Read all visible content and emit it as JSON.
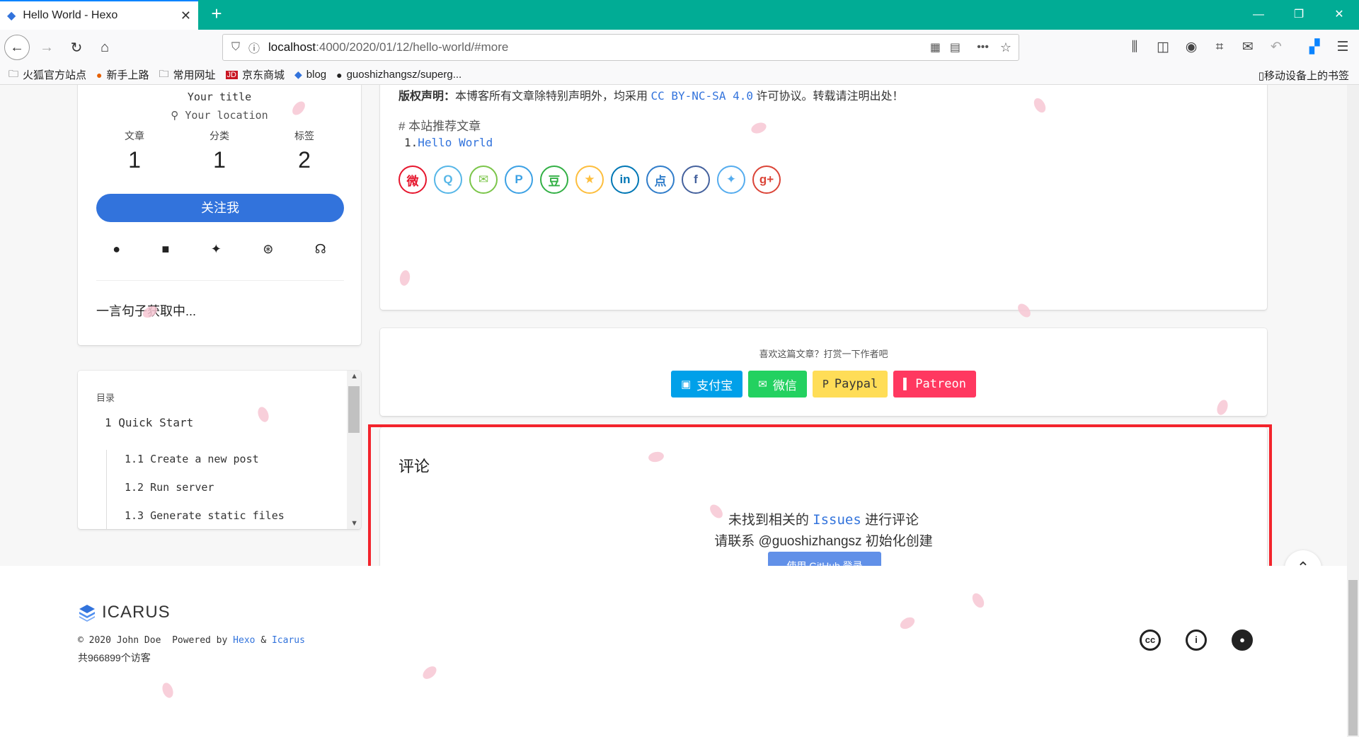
{
  "browser": {
    "tab_title": "Hello World - Hexo",
    "url_host": "localhost",
    "url_path": ":4000/2020/01/12/hello-world/#more",
    "bookmarks": [
      "火狐官方站点",
      "新手上路",
      "常用网址",
      "京东商城",
      "blog",
      "guoshizhangsz/superg..."
    ],
    "mobile_bookmarks": "移动设备上的书签"
  },
  "profile": {
    "title": "Your title",
    "location": "Your location",
    "stats": [
      {
        "label": "文章",
        "value": "1"
      },
      {
        "label": "分类",
        "value": "1"
      },
      {
        "label": "标签",
        "value": "2"
      }
    ],
    "follow_label": "关注我",
    "hitokoto": "一言句子获取中..."
  },
  "toc": {
    "title": "目录",
    "items": [
      "1 Quick Start",
      "1.1 Create a new post",
      "1.2 Run server",
      "1.3 Generate static files"
    ]
  },
  "article": {
    "copyright_label": "版权声明：",
    "copyright_text": "本博客所有文章除特别声明外，均采用",
    "license": "CC BY-NC-SA 4.0",
    "copyright_tail": "许可协议。转载请注明出处！",
    "recommend_heading": "# 本站推荐文章",
    "recommend_num": "1.",
    "recommend_item": "Hello World",
    "share_icons": [
      "weibo-icon",
      "qq-icon",
      "wechat-icon",
      "pinterest-icon",
      "douban-icon",
      "qzone-icon",
      "linkedin-icon",
      "diandian-icon",
      "facebook-icon",
      "twitter-icon",
      "google-plus-icon"
    ]
  },
  "donate": {
    "title": "喜欢这篇文章？打赏一下作者吧",
    "buttons": [
      {
        "label": "支付宝",
        "color": "#00a0e9"
      },
      {
        "label": "微信",
        "color": "#23d160"
      },
      {
        "label": "Paypal",
        "color": "#ffdd57"
      },
      {
        "label": "Patreon",
        "color": "#ff3860"
      }
    ]
  },
  "comment": {
    "title": "评论",
    "msg_prefix": "未找到相关的",
    "issues_link": "Issues",
    "msg_suffix": "进行评论",
    "msg2": "请联系 @guoshizhangsz 初始化创建",
    "login_label": "使用 GitHub 登录"
  },
  "footer": {
    "logo_text": "ICARUS",
    "copyright": "© 2020 John Doe",
    "powered_by": "Powered by",
    "hexo": "Hexo",
    "amp": "&",
    "icarus": "Icarus",
    "visitors": "共966899个访客"
  }
}
